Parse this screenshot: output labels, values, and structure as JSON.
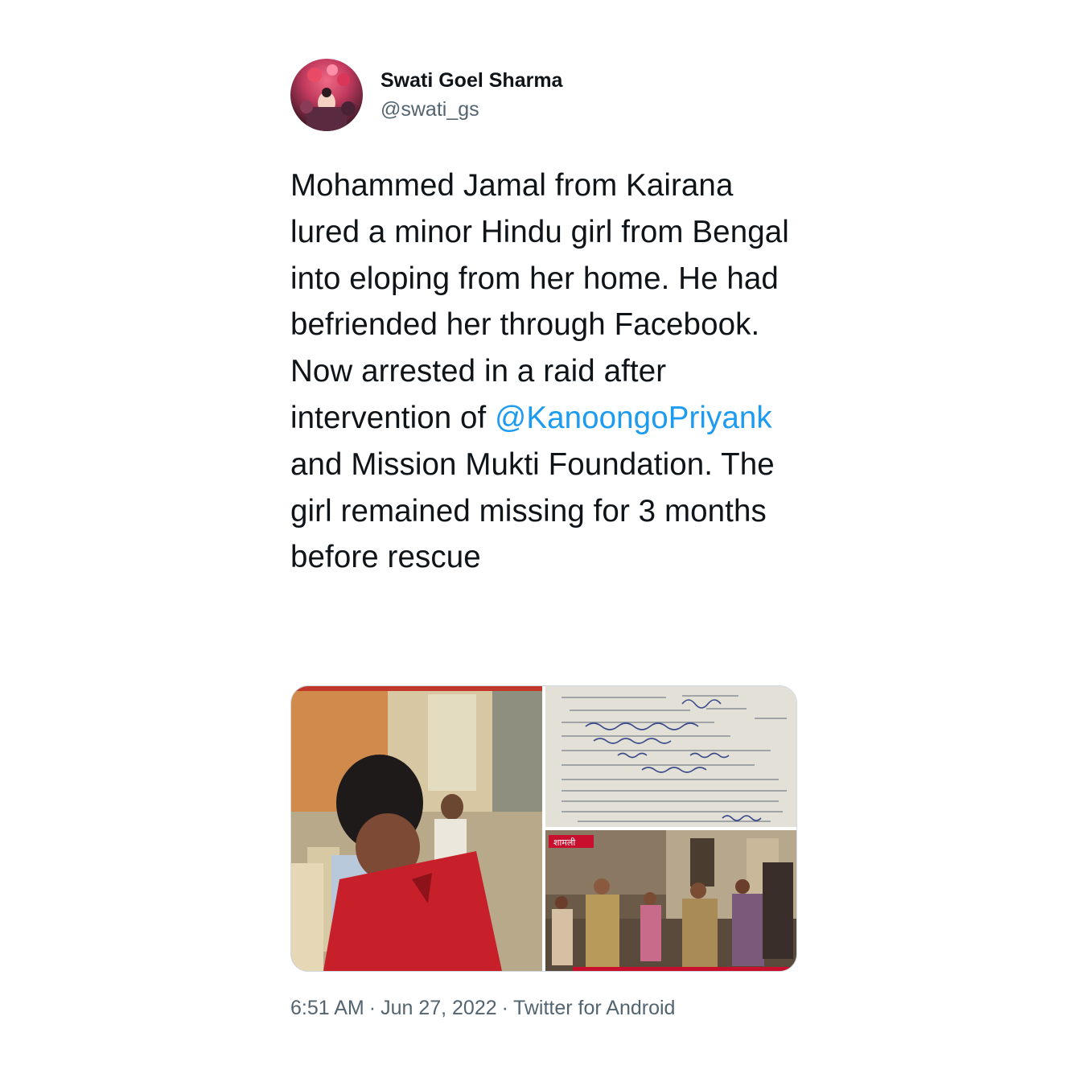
{
  "user": {
    "display_name": "Swati Goel Sharma",
    "handle": "@swati_gs",
    "avatar_icon": "profile-photo"
  },
  "tweet": {
    "text_before_mention": "Mohammed Jamal from Kairana lured a minor Hindu girl from Bengal into eloping from her home. He had befriended her through Facebook. Now arrested in a raid after intervention of ",
    "mention": "@KanoongoPriyank",
    "text_after_mention": " and Mission Mukti Foundation. The girl remained missing for 3 months before rescue",
    "mention_color": "#1d9bf0"
  },
  "media": {
    "images": [
      {
        "name": "photo-man-red-shirt"
      },
      {
        "name": "photo-court-document"
      },
      {
        "name": "photo-police-news-still",
        "overlay_label": "शामली"
      }
    ]
  },
  "meta": {
    "time": "6:51 AM",
    "date": "Jun 27, 2022",
    "source": "Twitter for Android",
    "separator": "·"
  }
}
